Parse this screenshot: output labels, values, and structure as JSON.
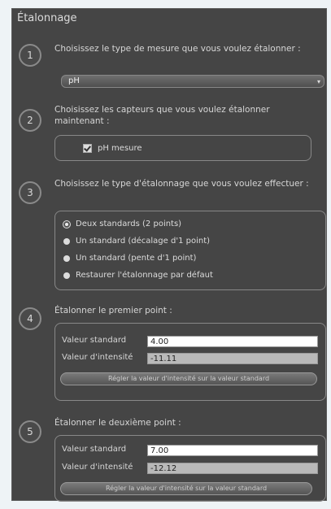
{
  "panel": {
    "title": "Étalonnage"
  },
  "step1": {
    "number": "1",
    "text": "Choisissez le type de mesure que vous voulez étalonner :",
    "dropdown_value": "pH",
    "dropdown_arrow": "▾"
  },
  "step2": {
    "number": "2",
    "text": "Choisissez les capteurs que vous voulez étalonner maintenant :",
    "sensor_label": "pH mesure",
    "sensor_checked": true
  },
  "step3": {
    "number": "3",
    "text": "Choisissez le type d'étalonnage que vous voulez effectuer :",
    "options": [
      {
        "label": "Deux standards (2 points)",
        "selected": true
      },
      {
        "label": "Un standard (décalage d'1 point)",
        "selected": false
      },
      {
        "label": "Un standard (pente d'1 point)",
        "selected": false
      },
      {
        "label": "Restaurer l'étalonnage par défaut",
        "selected": false
      }
    ]
  },
  "step4": {
    "number": "4",
    "text": "Étalonner le premier point :",
    "standard_label": "Valeur standard",
    "standard_value": "4.00",
    "intensity_label": "Valeur d'intensité",
    "intensity_value": "-11.11",
    "button_label": "Régler la valeur d'intensité sur la valeur standard"
  },
  "step5": {
    "number": "5",
    "text": "Étalonner le deuxième point :",
    "standard_label": "Valeur standard",
    "standard_value": "7.00",
    "intensity_label": "Valeur d'intensité",
    "intensity_value": "-12.12",
    "button_label": "Régler la valeur d'intensité sur la valeur standard"
  }
}
